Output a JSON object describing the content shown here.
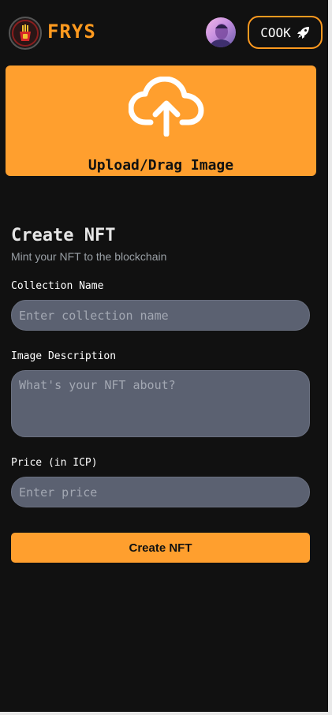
{
  "header": {
    "brand": "FRYS",
    "cook_label": "COOK"
  },
  "upload": {
    "label": "Upload/Drag Image"
  },
  "form": {
    "title": "Create NFT",
    "subtitle": "Mint your NFT to the blockchain",
    "collection_label": "Collection Name",
    "collection_placeholder": "Enter collection name",
    "description_label": "Image Description",
    "description_placeholder": "What's your NFT about?",
    "price_label": "Price (in ICP)",
    "price_placeholder": "Enter price",
    "submit_label": "Create NFT"
  },
  "colors": {
    "accent": "#ff9f2e",
    "background": "#111111",
    "input_bg": "#5b6171"
  },
  "icons": [
    "frys-logo",
    "avatar",
    "rocket-icon",
    "cloud-upload-icon"
  ]
}
